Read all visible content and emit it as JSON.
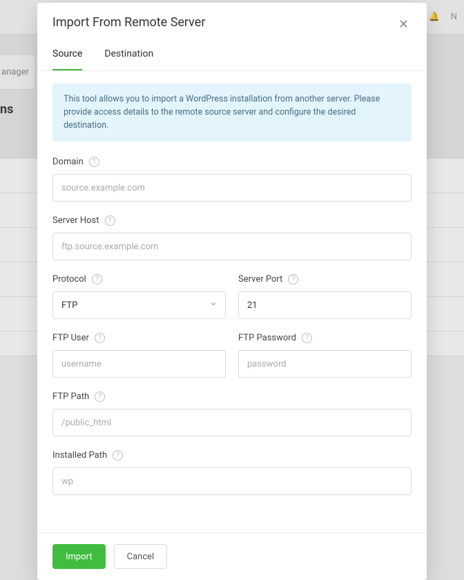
{
  "background": {
    "topbar_text": "N",
    "sidebar_item": "anager",
    "heading": "ns"
  },
  "modal": {
    "title": "Import From Remote Server",
    "close_label": "×",
    "tabs": {
      "source": "Source",
      "destination": "Destination"
    },
    "info": "This tool allows you to import a WordPress installation from another server. Please provide access details to the remote source server and configure the desired destination.",
    "fields": {
      "domain": {
        "label": "Domain",
        "placeholder": "source.example.com"
      },
      "server_host": {
        "label": "Server Host",
        "placeholder": "ftp.source.example.com"
      },
      "protocol": {
        "label": "Protocol",
        "value": "FTP"
      },
      "server_port": {
        "label": "Server Port",
        "value": "21"
      },
      "ftp_user": {
        "label": "FTP User",
        "placeholder": "username"
      },
      "ftp_password": {
        "label": "FTP Password",
        "placeholder": "password"
      },
      "ftp_path": {
        "label": "FTP Path",
        "placeholder": "/public_html"
      },
      "installed_path": {
        "label": "Installed Path",
        "placeholder": "wp"
      }
    },
    "footer": {
      "import": "Import",
      "cancel": "Cancel"
    }
  }
}
